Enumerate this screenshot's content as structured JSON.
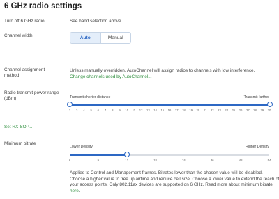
{
  "section_title": "6 GHz radio settings",
  "turn_off": {
    "label": "Turn off 6 GHz radio",
    "value": "See band selection above."
  },
  "channel_width": {
    "label": "Channel width",
    "options": [
      "Auto",
      "Manual"
    ],
    "selected": "Auto"
  },
  "channel_assignment": {
    "label_line1": "Channel assignment",
    "label_line2": "method",
    "description": "Unless manually overridden, AutoChannel will assign radios to channels with low interference.",
    "link": "Change channels used by AutoChannel..."
  },
  "power_range": {
    "label_line1": "Radio transmit power range",
    "label_line2": "(dBm)",
    "min_label": "Transmit shorter distance",
    "max_label": "Transmit farther",
    "ticks": [
      "2",
      "3",
      "4",
      "5",
      "6",
      "7",
      "8",
      "9",
      "10",
      "11",
      "12",
      "13",
      "14",
      "15",
      "16",
      "17",
      "18",
      "19",
      "20",
      "21",
      "22",
      "23",
      "24",
      "25",
      "26",
      "27",
      "28",
      "29",
      "30"
    ],
    "range": [
      2,
      30
    ],
    "selected_low": 2,
    "selected_high": 30
  },
  "rx_sop_link": "Set RX-SOP...",
  "min_bitrate": {
    "label": "Minimum bitrate",
    "min_label": "Lower Density",
    "max_label": "Higher Density",
    "ticks": [
      "6",
      "9",
      "12",
      "18",
      "24",
      "36",
      "48",
      "54"
    ],
    "selected": "12",
    "help_line1": "Applies to Control and Management frames. Bitrates lower than the chosen value will be disabled.",
    "help_line2": "Choose a higher value to free up airtime and reduce cell size. Choose a lower value to extend the reach of",
    "help_line3": "your access points. Only 802.11ax devices are supported on 6 GHz. Read more about minimum bitrate",
    "help_link": "here",
    "help_end": "."
  },
  "colors": {
    "accent": "#2d68c4",
    "link": "#2f8f3e",
    "track": "#d9dde3"
  }
}
